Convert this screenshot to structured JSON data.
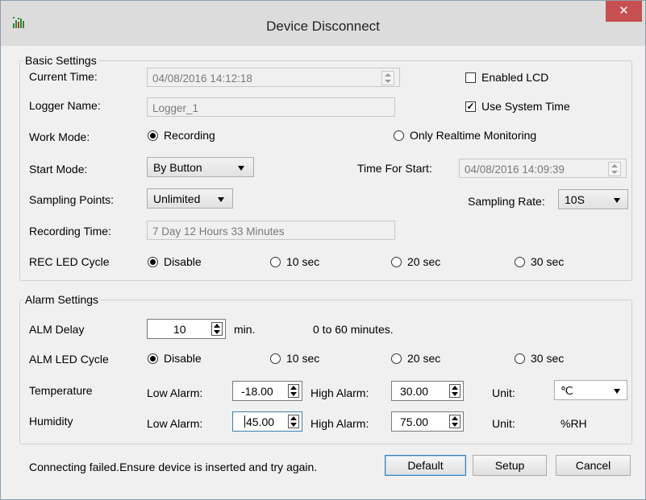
{
  "window": {
    "title": "Device Disconnect",
    "close_label": "✕"
  },
  "basic": {
    "legend": "Basic Settings",
    "current_time_label": "Current Time:",
    "current_time_value": "04/08/2016 14:12:18",
    "enabled_lcd_label": "Enabled LCD",
    "enabled_lcd_checked": false,
    "logger_name_label": "Logger Name:",
    "logger_name_value": "Logger_1",
    "use_system_time_label": "Use System Time",
    "use_system_time_checked": true,
    "work_mode_label": "Work Mode:",
    "work_mode_recording": "Recording",
    "work_mode_realtime": "Only Realtime Monitoring",
    "start_mode_label": "Start Mode:",
    "start_mode_value": "By Button",
    "time_for_start_label": "Time For Start:",
    "time_for_start_value": "04/08/2016 14:09:39",
    "sampling_points_label": "Sampling Points:",
    "sampling_points_value": "Unlimited",
    "sampling_rate_label": "Sampling Rate:",
    "sampling_rate_value": "10S",
    "recording_time_label": "Recording Time:",
    "recording_time_value": "7 Day 12 Hours 33 Minutes",
    "rec_led_label": "REC LED Cycle",
    "rec_led_options": [
      "Disable",
      "10 sec",
      "20 sec",
      "30 sec"
    ]
  },
  "alarm": {
    "legend": "Alarm Settings",
    "alm_delay_label": "ALM Delay",
    "alm_delay_value": "10",
    "alm_delay_unit": "min.",
    "alm_delay_hint": "0 to 60 minutes.",
    "alm_led_label": "ALM LED Cycle",
    "alm_led_options": [
      "Disable",
      "10 sec",
      "20 sec",
      "30 sec"
    ],
    "temperature_label": "Temperature",
    "humidity_label": "Humidity",
    "low_alarm_label": "Low Alarm:",
    "high_alarm_label": "High Alarm:",
    "unit_label": "Unit:",
    "temp_low": "-18.00",
    "temp_high": "30.00",
    "temp_unit": "℃",
    "hum_low": "45.00",
    "hum_high": "75.00",
    "hum_unit": "%RH"
  },
  "footer": {
    "status": "Connecting failed.Ensure device is inserted and try again.",
    "default_label": "Default",
    "setup_label": "Setup",
    "cancel_label": "Cancel"
  }
}
